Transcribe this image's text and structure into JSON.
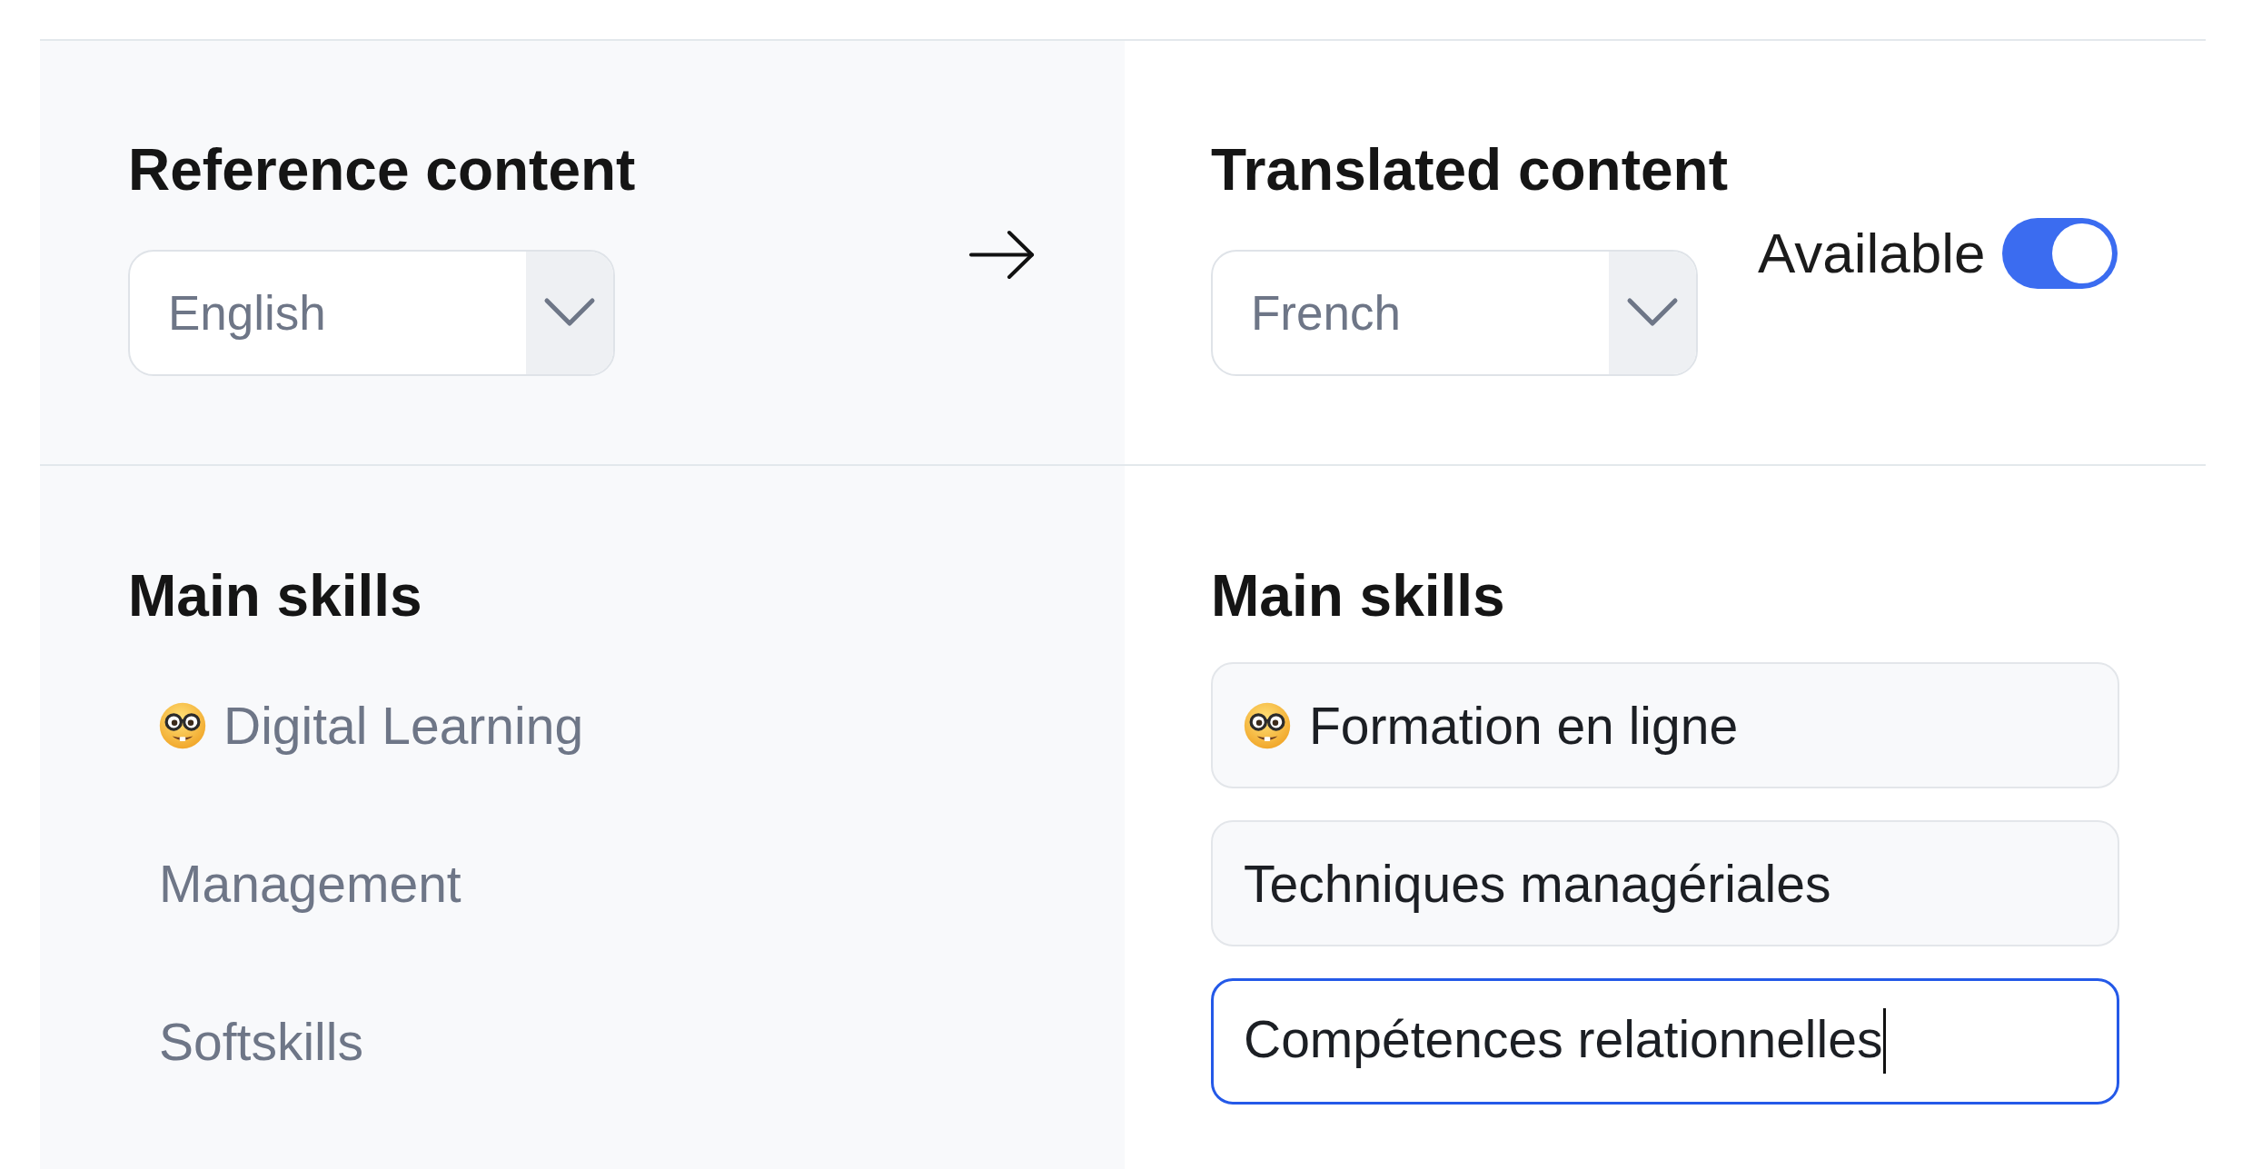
{
  "reference": {
    "title": "Reference content",
    "language": "English"
  },
  "translated": {
    "title": "Translated content",
    "language": "French",
    "available": {
      "label": "Available",
      "on": true
    }
  },
  "reference_skills": {
    "title": "Main skills",
    "items": [
      {
        "text": "Digital Learning",
        "emoji": true
      },
      {
        "text": "Management",
        "emoji": false
      },
      {
        "text": "Softskills",
        "emoji": false
      }
    ]
  },
  "translated_skills": {
    "title": "Main skills",
    "fields": [
      {
        "value": "Formation en ligne",
        "emoji": true,
        "focused": false
      },
      {
        "value": "Techniques managériales",
        "emoji": false,
        "focused": false
      },
      {
        "value": "Compétences relationnelles",
        "emoji": false,
        "focused": true
      }
    ]
  }
}
